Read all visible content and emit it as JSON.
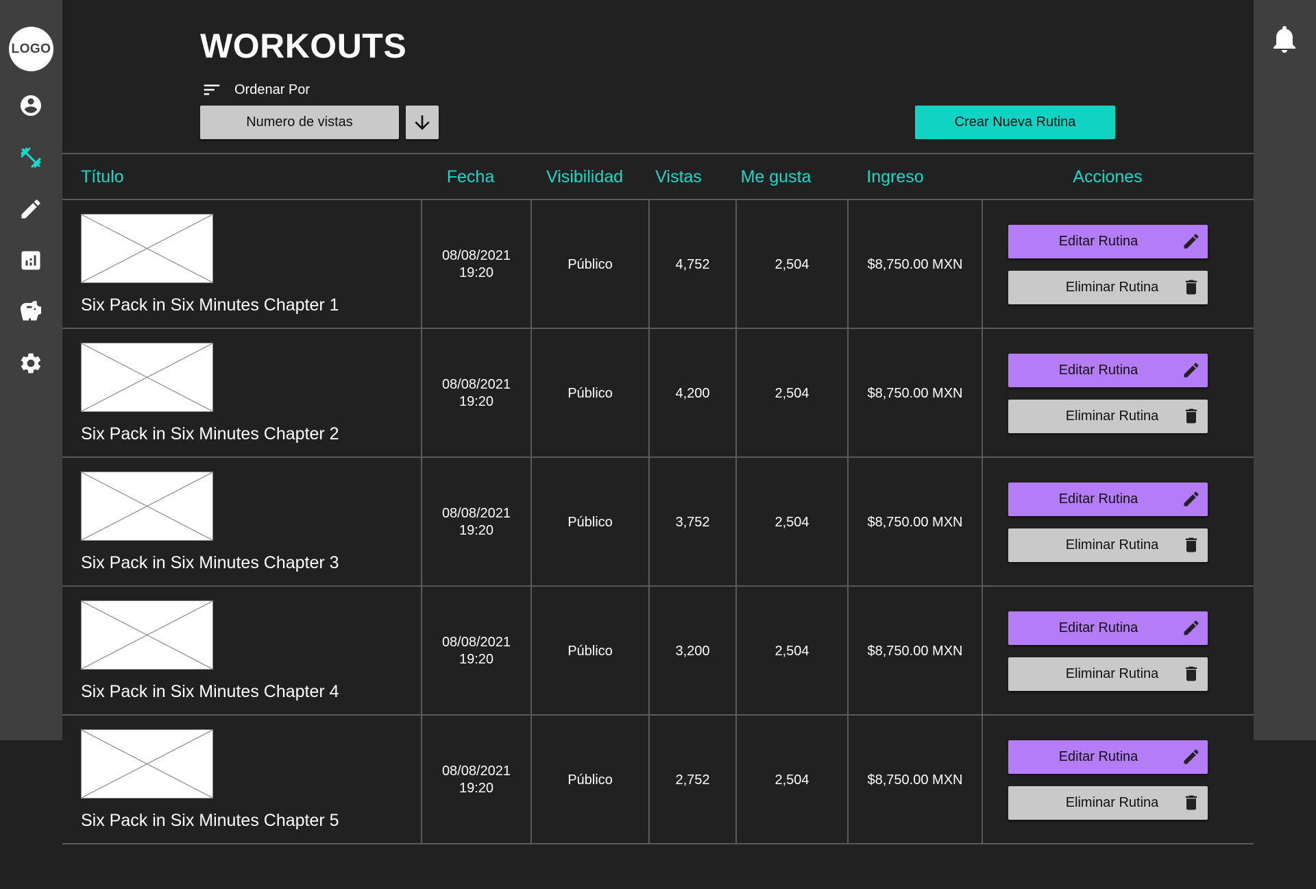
{
  "sidebar": {
    "logo": "LOGO",
    "items": [
      {
        "icon": "account-icon",
        "active": false
      },
      {
        "icon": "dumbbell-icon",
        "active": true
      },
      {
        "icon": "pencil-icon",
        "active": false
      },
      {
        "icon": "analytics-icon",
        "active": false
      },
      {
        "icon": "piggy-bank-icon",
        "active": false
      },
      {
        "icon": "gear-icon",
        "active": false
      }
    ]
  },
  "header": {
    "title": "WORKOUTS",
    "sort_label": "Ordenar Por",
    "sort_value": "Numero de vistas",
    "create_button": "Crear Nueva Rutina"
  },
  "table": {
    "headers": [
      "Título",
      "Fecha",
      "Visibilidad",
      "Vistas",
      "Me gusta",
      "Ingreso",
      "Acciones"
    ],
    "edit_label": "Editar Rutina",
    "delete_label": "Eliminar Rutina",
    "rows": [
      {
        "title": "Six Pack in Six Minutes Chapter 1",
        "date": "08/08/2021",
        "time": "19:20",
        "visibility": "Público",
        "views": "4,752",
        "likes": "2,504",
        "income": "$8,750.00 MXN"
      },
      {
        "title": "Six Pack in Six Minutes Chapter 2",
        "date": "08/08/2021",
        "time": "19:20",
        "visibility": "Público",
        "views": "4,200",
        "likes": "2,504",
        "income": "$8,750.00 MXN"
      },
      {
        "title": "Six Pack in Six Minutes Chapter 3",
        "date": "08/08/2021",
        "time": "19:20",
        "visibility": "Público",
        "views": "3,752",
        "likes": "2,504",
        "income": "$8,750.00 MXN"
      },
      {
        "title": "Six Pack in Six Minutes Chapter 4",
        "date": "08/08/2021",
        "time": "19:20",
        "visibility": "Público",
        "views": "3,200",
        "likes": "2,504",
        "income": "$8,750.00 MXN"
      },
      {
        "title": "Six Pack in Six Minutes Chapter 5",
        "date": "08/08/2021",
        "time": "19:20",
        "visibility": "Público",
        "views": "2,752",
        "likes": "2,504",
        "income": "$8,750.00 MXN"
      }
    ]
  },
  "colors": {
    "background": "#212121",
    "sidebar": "#3f3f3f",
    "accent_teal": "#11d3c3",
    "edit_purple": "#b57cf8",
    "neutral_button": "#c9c9c9"
  }
}
